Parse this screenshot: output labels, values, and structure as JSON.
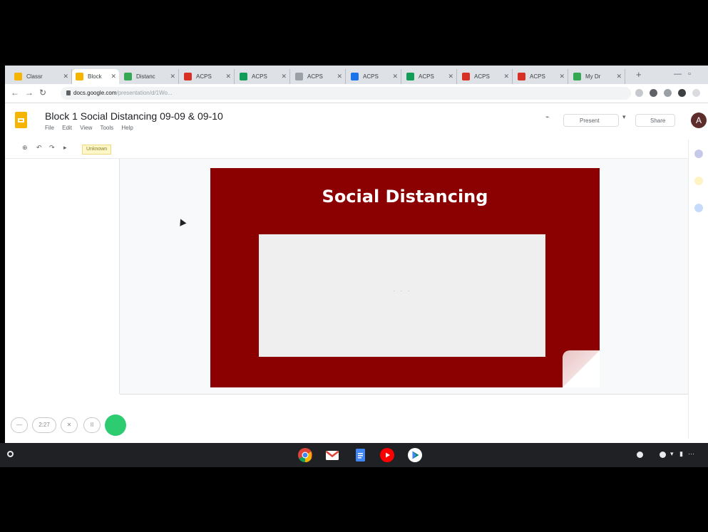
{
  "browser": {
    "tabs": [
      {
        "label": "Classr",
        "color": "#f4b400"
      },
      {
        "label": "Block",
        "color": "#f4b400",
        "active": true
      },
      {
        "label": "Distanc",
        "color": "#34a853"
      },
      {
        "label": "ACPS",
        "color": "#d93025"
      },
      {
        "label": "ACPS",
        "color": "#0f9d58"
      },
      {
        "label": "ACPS",
        "color": "#9aa0a6"
      },
      {
        "label": "ACPS",
        "color": "#1a73e8"
      },
      {
        "label": "ACPS",
        "color": "#0f9d58"
      },
      {
        "label": "ACPS",
        "color": "#d93025"
      },
      {
        "label": "ACPS",
        "color": "#d93025"
      },
      {
        "label": "My Dr",
        "color": "#34a853"
      }
    ],
    "address": {
      "domain": "docs.google.com",
      "path": "/presentation/d/1Wo..."
    }
  },
  "slides": {
    "doc_title": "Block 1 Social Distancing 09-09 & 09-10",
    "menu": [
      "File",
      "Edit",
      "View",
      "Tools",
      "Help"
    ],
    "present_label": "Present",
    "share_label": "Share",
    "avatar_initial": "A",
    "toolbar_chip": "Unknown"
  },
  "slide": {
    "title": "Social Distancing",
    "placeholder": "· · ·",
    "background": "#8b0000"
  },
  "recorder": {
    "counter": "2:27"
  },
  "shelf": {
    "apps": [
      "chrome-icon",
      "gmail-icon",
      "docs-icon",
      "youtube-icon",
      "play-store-icon"
    ]
  }
}
